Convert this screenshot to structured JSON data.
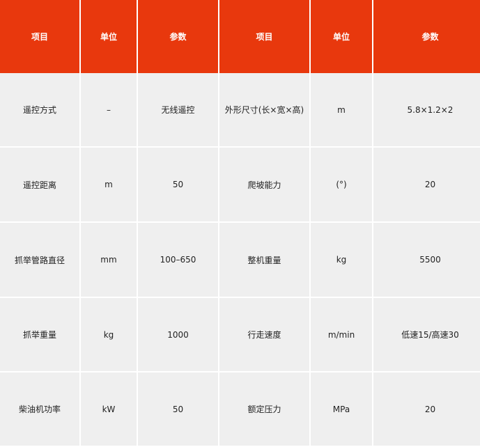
{
  "header": [
    "项目",
    "单位",
    "参数",
    "项目",
    "单位",
    "参数"
  ],
  "rows": [
    [
      "遥控方式",
      "–",
      "无线遥控",
      "外形尺寸(长×宽×高)",
      "m",
      "5.8×1.2×2"
    ],
    [
      "遥控距离",
      "m",
      "50",
      "爬坡能力",
      "(°)",
      "20"
    ],
    [
      "抓举管路直径",
      "mm",
      "100–650",
      "整机重量",
      "kg",
      "5500"
    ],
    [
      "抓举重量",
      "kg",
      "1000",
      "行走速度",
      "m/min",
      "低速15/高速30"
    ],
    [
      "柴油机功率",
      "kW",
      "50",
      "额定压力",
      "MPa",
      "20"
    ]
  ],
  "colors": {
    "header_bg": "#e8380d",
    "header_text": "#ffffff",
    "cell_bg": "#efefef",
    "cell_text": "#222222"
  }
}
